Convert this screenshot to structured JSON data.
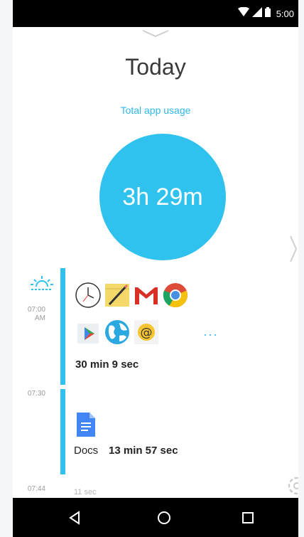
{
  "status_bar": {
    "time": "5:00",
    "icons": [
      "wifi-icon",
      "signal-icon",
      "battery-icon"
    ]
  },
  "header": {
    "title": "Today",
    "subtitle": "Total app usage"
  },
  "summary": {
    "total_time": "3h 29m"
  },
  "timeline": [
    {
      "time": "07:00\nAM",
      "apps": [
        "clock-icon",
        "notes-icon",
        "gmail-icon",
        "chrome-icon",
        "play-store-icon",
        "browser-icon",
        "email-icon"
      ],
      "more": "···",
      "duration": "30 min 9 sec"
    },
    {
      "time": "07:30",
      "app": "Docs",
      "duration": "13 min 57 sec"
    },
    {
      "time": "07:44",
      "duration": "11 sec"
    }
  ],
  "colors": {
    "accent": "#30c2ee",
    "text": "#3a3a3a",
    "muted": "#9a9a9a"
  }
}
